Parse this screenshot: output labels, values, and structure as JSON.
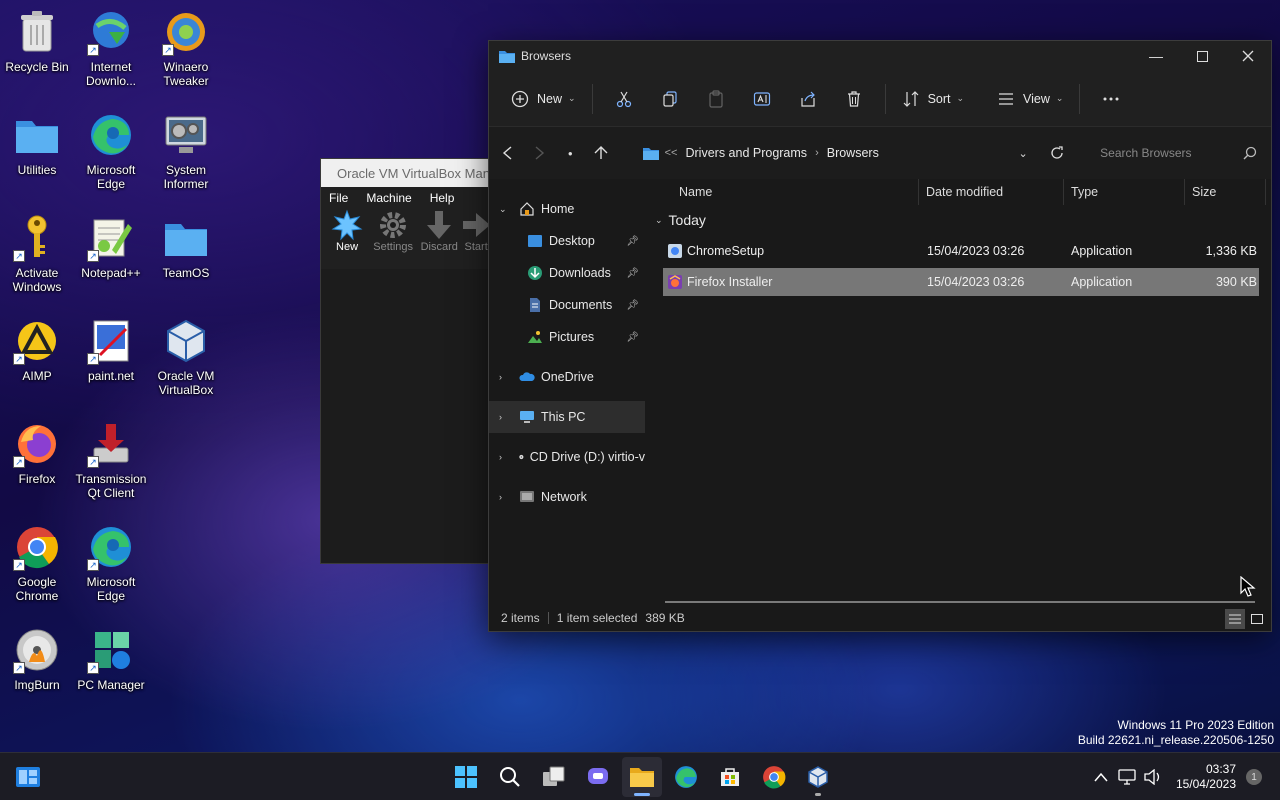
{
  "desktop": {
    "icons": [
      {
        "label": "Recycle Bin"
      },
      {
        "label": "Internet Downlo..."
      },
      {
        "label": "Winaero Tweaker"
      },
      {
        "label": "Utilities"
      },
      {
        "label": "Microsoft Edge"
      },
      {
        "label": "System Informer"
      },
      {
        "label": "Activate Windows"
      },
      {
        "label": "Notepad++"
      },
      {
        "label": "TeamOS"
      },
      {
        "label": "AIMP"
      },
      {
        "label": "paint.net"
      },
      {
        "label": "Oracle VM VirtualBox"
      },
      {
        "label": "Firefox"
      },
      {
        "label": "Transmission Qt Client"
      },
      {
        "label": "Google Chrome"
      },
      {
        "label": "Microsoft Edge"
      },
      {
        "label": "ImgBurn"
      },
      {
        "label": "PC Manager"
      }
    ]
  },
  "virtualbox": {
    "title": "Oracle VM VirtualBox Man",
    "menu": [
      "File",
      "Machine",
      "Help"
    ],
    "tools": [
      "New",
      "Settings",
      "Discard",
      "Start"
    ]
  },
  "explorer": {
    "title": "Browsers",
    "commands": {
      "new": "New",
      "sort": "Sort",
      "view": "View"
    },
    "breadcrumb": {
      "overflow": "<<",
      "parts": [
        "Drivers and Programs",
        "Browsers"
      ]
    },
    "search_placeholder": "Search Browsers",
    "nav": {
      "home": "Home",
      "desktop": "Desktop",
      "downloads": "Downloads",
      "documents": "Documents",
      "pictures": "Pictures",
      "onedrive": "OneDrive",
      "thispc": "This PC",
      "cddrive": "CD Drive (D:) virtio-v",
      "network": "Network"
    },
    "columns": [
      "Name",
      "Date modified",
      "Type",
      "Size"
    ],
    "group": "Today",
    "files": [
      {
        "name": "ChromeSetup",
        "date": "15/04/2023 03:26",
        "type": "Application",
        "size": "1,336 KB"
      },
      {
        "name": "Firefox Installer",
        "date": "15/04/2023 03:26",
        "type": "Application",
        "size": "390 KB"
      }
    ],
    "status": {
      "items": "2 items",
      "selected": "1 item selected",
      "selected_size": "389 KB"
    }
  },
  "watermark": {
    "line1": "Windows 11 Pro 2023 Edition",
    "line2": "Build 22621.ni_release.220506-1250"
  },
  "taskbar": {
    "time": "03:37",
    "date": "15/04/2023",
    "notifications": "1"
  },
  "colors": {
    "accent": "#60a5fa",
    "folder": "#4fa3e6",
    "selection": "#777777"
  }
}
